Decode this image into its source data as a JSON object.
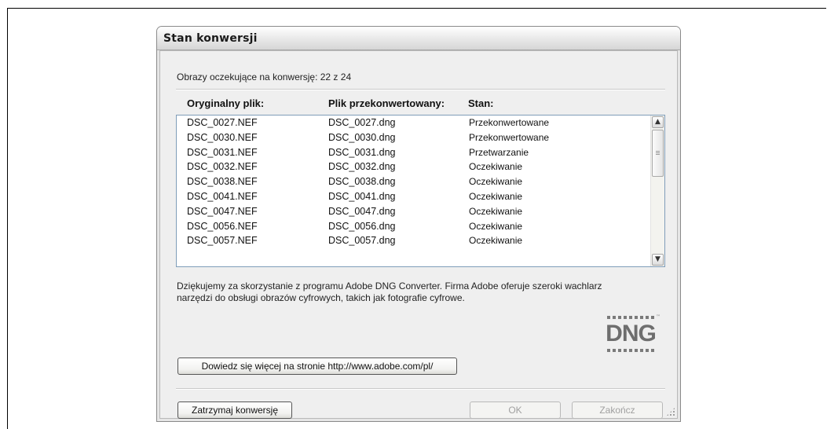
{
  "dialog": {
    "title": "Stan konwersji",
    "pending_text": "Obrazy oczekujące na konwersję: 22 z 24",
    "columns": [
      "Oryginalny plik:",
      "Plik przekonwertowany:",
      "Stan:"
    ],
    "rows": [
      {
        "original": "DSC_0027.NEF",
        "converted": "DSC_0027.dng",
        "status": "Przekonwertowane"
      },
      {
        "original": "DSC_0030.NEF",
        "converted": "DSC_0030.dng",
        "status": "Przekonwertowane"
      },
      {
        "original": "DSC_0031.NEF",
        "converted": "DSC_0031.dng",
        "status": "Przetwarzanie"
      },
      {
        "original": "DSC_0032.NEF",
        "converted": "DSC_0032.dng",
        "status": "Oczekiwanie"
      },
      {
        "original": "DSC_0038.NEF",
        "converted": "DSC_0038.dng",
        "status": "Oczekiwanie"
      },
      {
        "original": "DSC_0041.NEF",
        "converted": "DSC_0041.dng",
        "status": "Oczekiwanie"
      },
      {
        "original": "DSC_0047.NEF",
        "converted": "DSC_0047.dng",
        "status": "Oczekiwanie"
      },
      {
        "original": "DSC_0056.NEF",
        "converted": "DSC_0056.dng",
        "status": "Oczekiwanie"
      },
      {
        "original": "DSC_0057.NEF",
        "converted": "DSC_0057.dng",
        "status": "Oczekiwanie"
      }
    ],
    "thanks_text": "Dziękujemy za skorzystanie z programu Adobe DNG Converter.  Firma Adobe oferuje szeroki wachlarz narzędzi do obsługi obrazów cyfrowych, takich jak fotografie cyfrowe.",
    "logo_text": "DNG",
    "logo_tm": "™",
    "learn_more_label": "Dowiedz się więcej na stronie http://www.adobe.com/pl/",
    "stop_label": "Zatrzymaj konwersję",
    "ok_label": "OK",
    "finish_label": "Zakończ"
  },
  "icons": {
    "scroll_up": "up-arrow-icon",
    "scroll_down": "down-arrow-icon"
  }
}
